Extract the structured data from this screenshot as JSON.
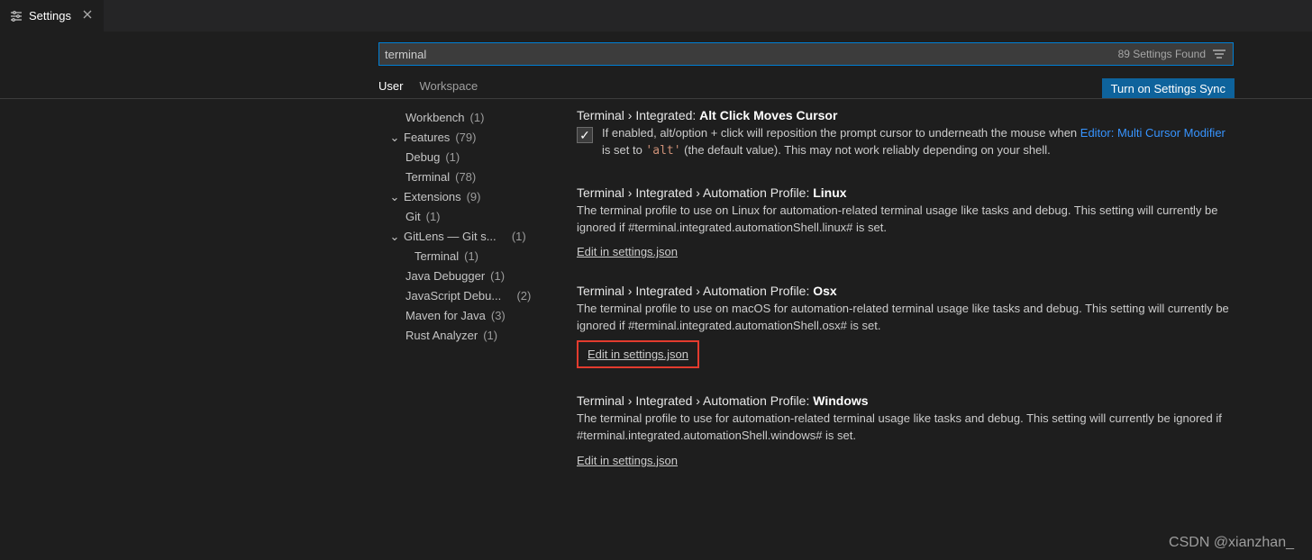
{
  "tab": {
    "title": "Settings"
  },
  "search": {
    "value": "terminal",
    "count_label": "89 Settings Found"
  },
  "scope": {
    "user": "User",
    "workspace": "Workspace",
    "sync": "Turn on Settings Sync"
  },
  "tree": {
    "workbench": {
      "label": "Workbench",
      "count": "(1)"
    },
    "features": {
      "label": "Features",
      "count": "(79)"
    },
    "debug": {
      "label": "Debug",
      "count": "(1)"
    },
    "terminal": {
      "label": "Terminal",
      "count": "(78)"
    },
    "extensions": {
      "label": "Extensions",
      "count": "(9)"
    },
    "git": {
      "label": "Git",
      "count": "(1)"
    },
    "gitlens": {
      "label": "GitLens — Git s...",
      "count": "(1)"
    },
    "gitlens_terminal": {
      "label": "Terminal",
      "count": "(1)"
    },
    "javadbg": {
      "label": "Java Debugger",
      "count": "(1)"
    },
    "jsdbg": {
      "label": "JavaScript Debu...",
      "count": "(2)"
    },
    "maven": {
      "label": "Maven for Java",
      "count": "(3)"
    },
    "rust": {
      "label": "Rust Analyzer",
      "count": "(1)"
    }
  },
  "settings": {
    "altclick": {
      "crumb": "Terminal › Integrated: ",
      "title": "Alt Click Moves Cursor",
      "desc_a": "If enabled, alt/option + click will reposition the prompt cursor to underneath the mouse when ",
      "link": "Editor: Multi Cursor Modifier",
      "desc_b": " is set to ",
      "code": "'alt'",
      "desc_c": " (the default value). This may not work reliably depending on your shell."
    },
    "linux": {
      "crumb": "Terminal › Integrated › Automation Profile: ",
      "title": "Linux",
      "desc": "The terminal profile to use on Linux for automation-related terminal usage like tasks and debug. This setting will currently be ignored if #terminal.integrated.automationShell.linux# is set.",
      "edit": "Edit in settings.json"
    },
    "osx": {
      "crumb": "Terminal › Integrated › Automation Profile: ",
      "title": "Osx",
      "desc": "The terminal profile to use on macOS for automation-related terminal usage like tasks and debug. This setting will currently be ignored if #terminal.integrated.automationShell.osx# is set.",
      "edit": "Edit in settings.json"
    },
    "win": {
      "crumb": "Terminal › Integrated › Automation Profile: ",
      "title": "Windows",
      "desc": "The terminal profile to use for automation-related terminal usage like tasks and debug. This setting will currently be ignored if #terminal.integrated.automationShell.windows# is set.",
      "edit": "Edit in settings.json"
    }
  },
  "watermark": "CSDN @xianzhan_"
}
